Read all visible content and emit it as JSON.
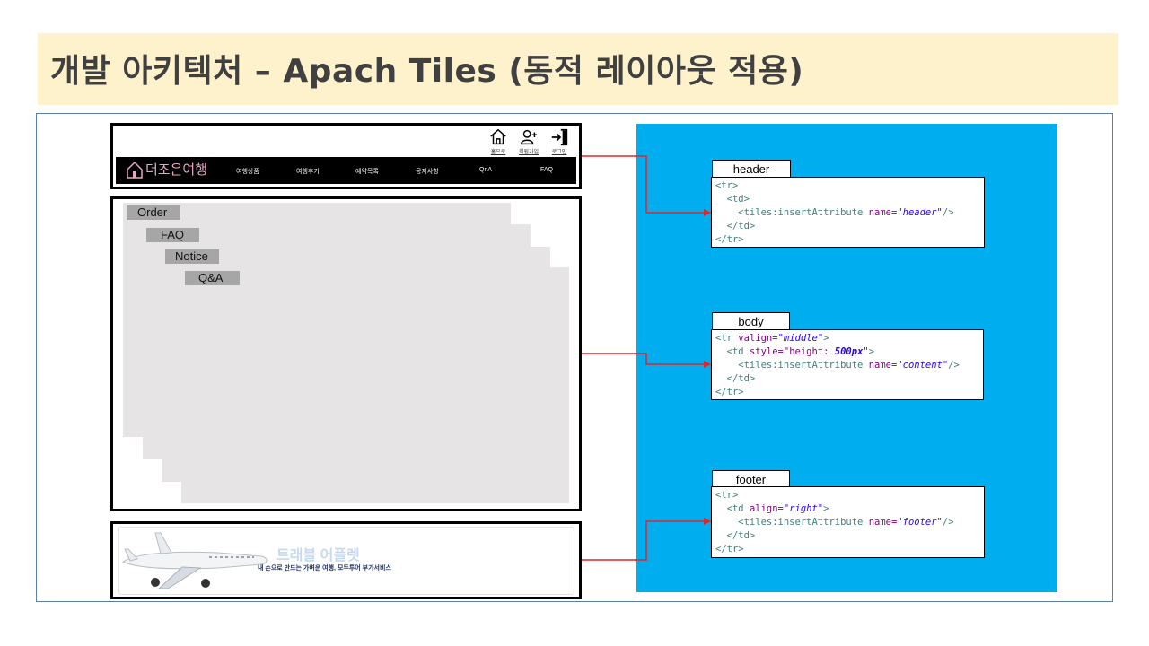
{
  "title": "개발 아키텍처 – Apach Tiles (동적 레이아웃 적용)",
  "header_mock": {
    "icons": [
      {
        "name": "home-icon",
        "label": "홈으로"
      },
      {
        "name": "add-user-icon",
        "label": "회원가입"
      },
      {
        "name": "login-icon",
        "label": "로그인"
      }
    ],
    "logo_text": "더조은여행",
    "nav": [
      "여행상품",
      "여행후기",
      "예약목록",
      "공지사항",
      "QnA",
      "FAQ"
    ]
  },
  "body_mock": {
    "tabs": [
      "Order",
      "FAQ",
      "Notice",
      "Q&A"
    ]
  },
  "footer_mock": {
    "title": "트래블 어플렛",
    "slogan": "내 손으로 만드는 가벼운 여행, 모두투어 부가서비스"
  },
  "code_blocks": {
    "header": {
      "label": "header",
      "l1": "<tr>",
      "l2_open": "  <td>",
      "l3_tag": "    <tiles:insertAttribute ",
      "l3_attr": "name=",
      "l3_val": "\"header\"",
      "l3_end": "/>",
      "l4": "  </td>",
      "l5": "</tr>"
    },
    "body": {
      "label": "body",
      "l1_tag": "<tr ",
      "l1_attr": "valign=",
      "l1_val": "\"middle\"",
      "l1_end": ">",
      "l2_tag": "  <td ",
      "l2_attr": "style=",
      "l2_q1": "\"height: ",
      "l2_val": "500px",
      "l2_q2": "\"",
      "l2_end": ">",
      "l3_tag": "    <tiles:insertAttribute ",
      "l3_attr": "name=",
      "l3_val": "\"content\"",
      "l3_end": "/>",
      "l4": "  </td>",
      "l5": "</tr>"
    },
    "footer": {
      "label": "footer",
      "l1": "<tr>",
      "l2_tag": "  <td ",
      "l2_attr": "align=",
      "l2_val": "\"right\"",
      "l2_end": ">",
      "l3_tag": "    <tiles:insertAttribute ",
      "l3_attr": "name=",
      "l3_val": "\"footer\"",
      "l3_end": "/>",
      "l4": "  </td>",
      "l5": "</tr>"
    }
  },
  "colors": {
    "title_band": "#fef2cc",
    "panel_blue": "#00aeef",
    "arrow_red": "#e0262a",
    "tab_gray": "#e6e4e4",
    "label_gray": "#a6a6a6"
  }
}
